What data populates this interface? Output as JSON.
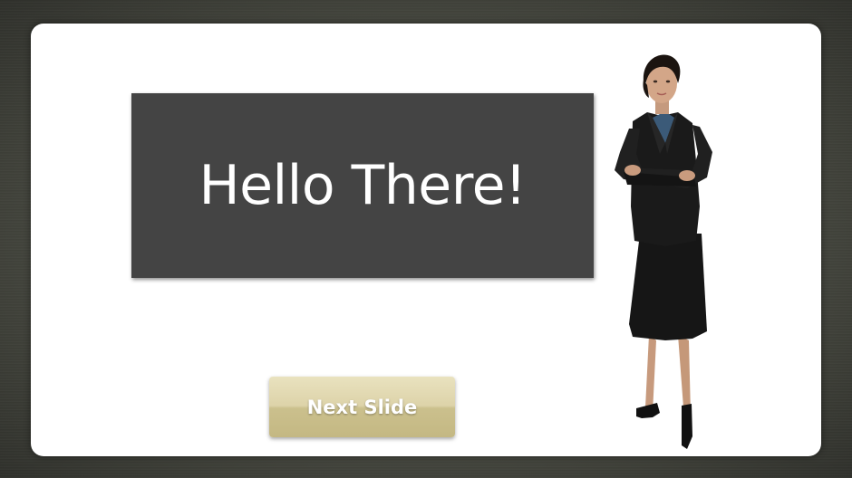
{
  "slide": {
    "title": "Hello There!",
    "next_button_label": "Next Slide"
  },
  "colors": {
    "background": "#4e5046",
    "stage": "#ffffff",
    "title_box": "#444444",
    "title_text": "#ffffff",
    "button_top": "#e9e2bf",
    "button_bottom": "#c4b883"
  },
  "icons": {
    "character": "businesswoman-figure"
  }
}
